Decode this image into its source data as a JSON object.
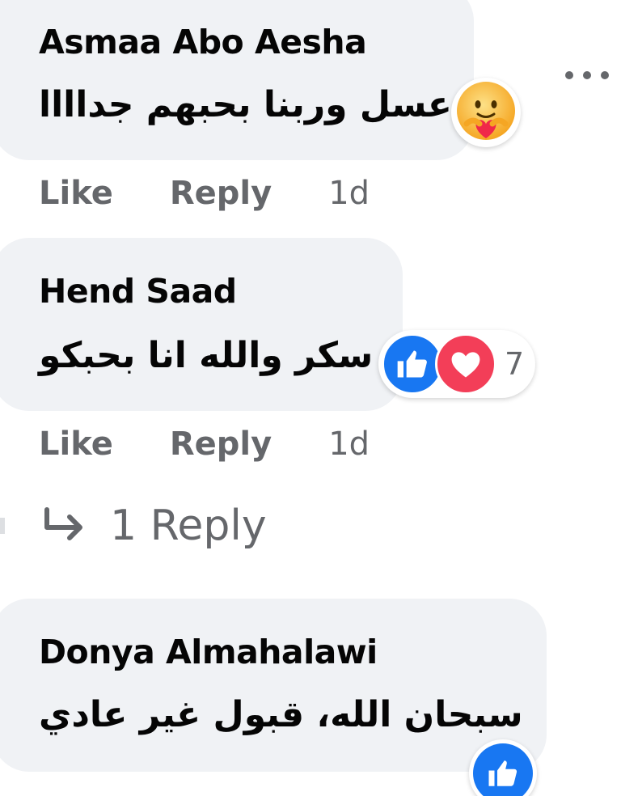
{
  "comments": [
    {
      "author": "Asmaa Abo Aesha",
      "text": "عسل وربنا بحبهم جداااا",
      "actions": {
        "like": "Like",
        "reply": "Reply",
        "time": "1d"
      },
      "reaction": {
        "type": "care",
        "icon": "care-emoji-icon"
      }
    },
    {
      "author": "Hend Saad",
      "text": "سكر والله انا بحبكو",
      "actions": {
        "like": "Like",
        "reply": "Reply",
        "time": "1d"
      },
      "reactions": {
        "icons": [
          "like-icon",
          "love-icon"
        ],
        "count": "7"
      },
      "replies_link": "1 Reply"
    },
    {
      "author": "Donya Almahalawi",
      "text": "سبحان الله، قبول غير عادي",
      "reaction": {
        "type": "like",
        "icon": "like-icon"
      }
    }
  ],
  "colors": {
    "bubble": "#f0f2f5",
    "secondary_text": "#65676b",
    "like_blue": "#1877f2",
    "love_red": "#f33e58",
    "care_yellow": "#f7b125"
  }
}
